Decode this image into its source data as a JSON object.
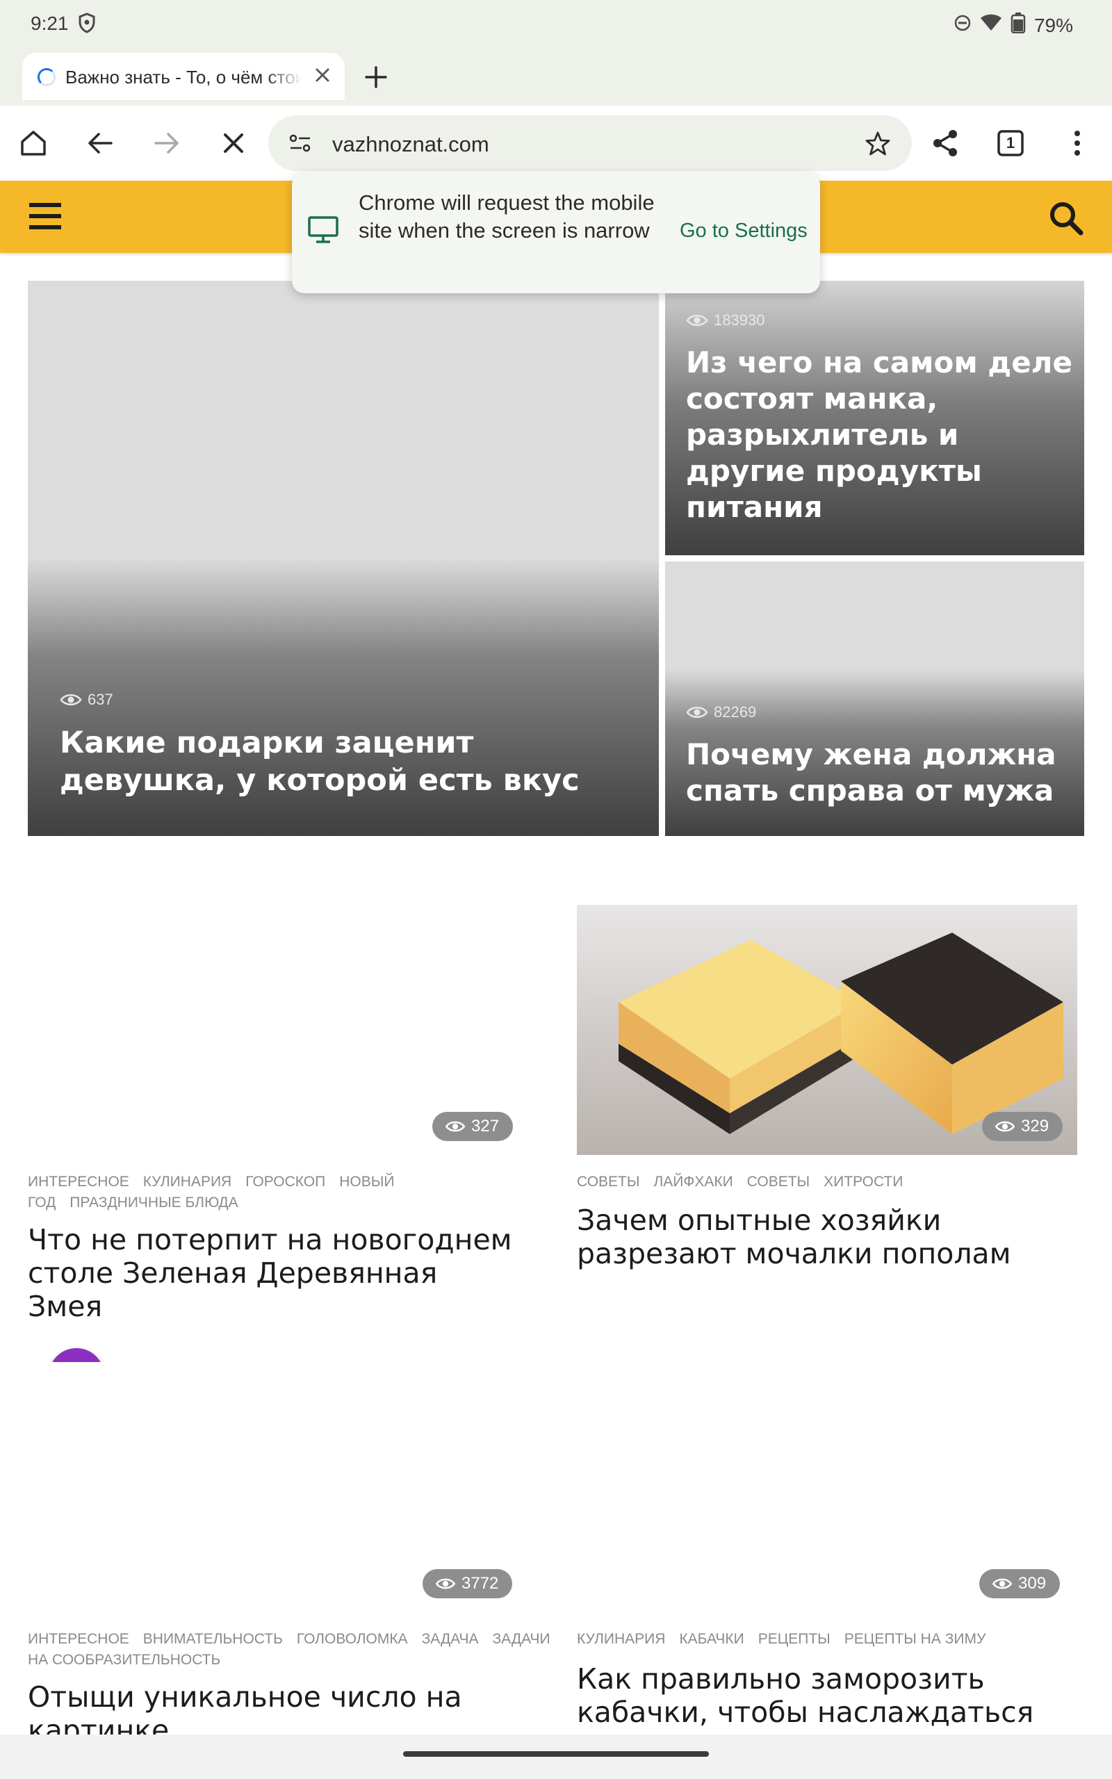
{
  "status_bar": {
    "time": "9:21",
    "battery": "79%"
  },
  "tab": {
    "title": "Важно знать - То, о чём стоит знать"
  },
  "toolbar": {
    "url": "vazhnoznat.com",
    "tab_count": "1"
  },
  "popup": {
    "message": "Chrome will request the mobile site when the screen is narrow",
    "action": "Go to Settings"
  },
  "hero": [
    {
      "views": "637",
      "title": "Какие подарки заценит девушка, у которой есть вкус"
    },
    {
      "views": "183930",
      "title": "Из чего на самом деле состоят манка, разрыхлитель и другие продукты питания"
    },
    {
      "views": "82269",
      "title": "Почему жена должна спать справа от мужа"
    }
  ],
  "posts": [
    {
      "views": "327",
      "tags": [
        "ИНТЕРЕСНОЕ",
        "КУЛИНАРИЯ",
        "ГОРОСКОП",
        "НОВЫЙ ГОД",
        "ПРАЗДНИЧНЫЕ БЛЮДА"
      ],
      "title": "Что не потерпит на новогоднем столе Зеленая Деревянная Змея"
    },
    {
      "views": "329",
      "tags": [
        "СОВЕТЫ",
        "ЛАЙФХАКИ",
        "СОВЕТЫ",
        "ХИТРОСТИ"
      ],
      "title": "Зачем опытные хозяйки разрезают мочалки пополам"
    },
    {
      "views": "3772",
      "tags": [
        "ИНТЕРЕСНОЕ",
        "ВНИМАТЕЛЬНОСТЬ",
        "ГОЛОВОЛОМКА",
        "ЗАДАЧА",
        "ЗАДАЧИ НА СООБРАЗИТЕЛЬНОСТЬ"
      ],
      "title": "Отыщи уникальное число на картинке"
    },
    {
      "views": "309",
      "tags": [
        "КУЛИНАРИЯ",
        "КАБАЧКИ",
        "РЕЦЕПТЫ",
        "РЕЦЕПТЫ НА ЗИМУ"
      ],
      "title": "Как правильно заморозить кабачки, чтобы наслаждаться ими всю зиму"
    }
  ],
  "colors": {
    "header": "#f4b829",
    "fab": "#8a2fc2",
    "popup_action": "#1b6e52"
  }
}
